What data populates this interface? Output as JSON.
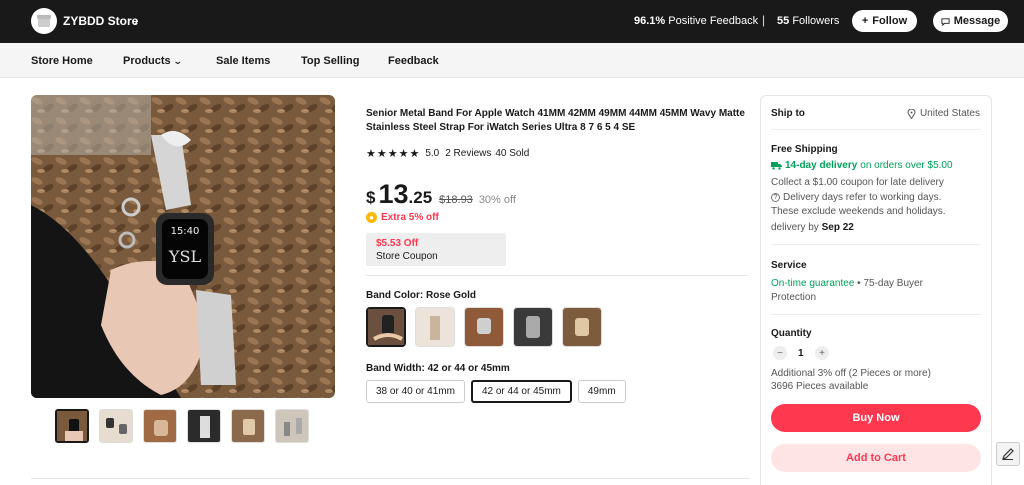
{
  "store": {
    "name": "ZYBDD Store",
    "positive_feedback_pct": "96.1%",
    "positive_feedback_label": "Positive Feedback",
    "followers_count": "55",
    "followers_label": "Followers",
    "follow_label": "Follow",
    "message_label": "Message"
  },
  "nav": {
    "items": [
      "Store Home",
      "Products",
      "Sale Items",
      "Top Selling",
      "Feedback"
    ]
  },
  "product": {
    "title": "Senior Metal Band For Apple Watch 41MM 42MM 49MM 44MM 45MM Wavy Matte Stainless Steel Strap For iWatch Series Ultra 8 7 6 5 4 SE",
    "rating": "5.0",
    "reviews": "2 Reviews",
    "sold": "40 Sold",
    "currency": "$",
    "price_int": "13",
    "price_dec": ".25",
    "original_price": "$18.93",
    "discount": "30% off",
    "extra_discount": "Extra 5% off",
    "coupon_amount": "$5.53 Off",
    "coupon_label": "Store Coupon",
    "band_color_label": "Band Color: Rose Gold",
    "band_width_label": "Band Width: 42 or 44 or 45mm",
    "sizes": [
      "38 or 40 or 41mm",
      "42 or 44 or 45mm",
      "49mm"
    ],
    "selected_size_index": 1,
    "watch_time": "15:40",
    "watch_logo": "YSL"
  },
  "shipping": {
    "ship_to_label": "Ship to",
    "country": "United States",
    "free_shipping_label": "Free Shipping",
    "delivery_highlight": "14-day delivery",
    "delivery_condition": "on orders over $5.00",
    "late_coupon": "Collect a $1.00 coupon for late delivery",
    "note_line1": "Delivery days refer to working days.",
    "note_line2": "These exclude weekends and holidays.",
    "delivery_by_label": "delivery by",
    "delivery_date": "Sep 22"
  },
  "service": {
    "label": "Service",
    "guarantee": "On-time guarantee",
    "buyer_protection_line1": "• 75-day Buyer",
    "buyer_protection_line2": "Protection"
  },
  "quantity": {
    "label": "Quantity",
    "value": "1",
    "additional_off": "Additional 3% off (2 Pieces or more)",
    "available": "3696 Pieces available"
  },
  "actions": {
    "buy_now": "Buy Now",
    "add_to_cart": "Add to Cart"
  },
  "colors": {
    "accent_red": "#fd384f",
    "green": "#00a15a",
    "header_bg": "#191919"
  }
}
